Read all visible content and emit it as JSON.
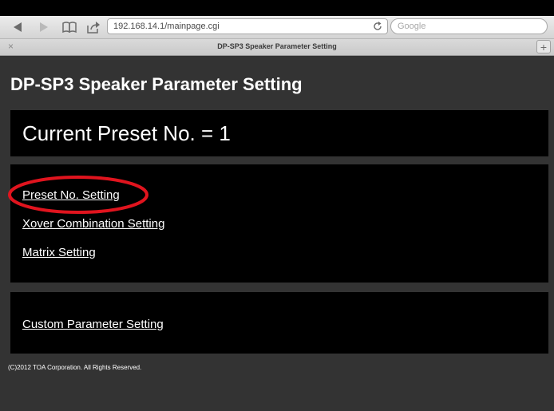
{
  "browser": {
    "url": "192.168.14.1/mainpage.cgi",
    "search_placeholder": "Google",
    "tab_title": "DP-SP3 Speaker Parameter Setting",
    "tab_close": "×",
    "tab_add": "+"
  },
  "page": {
    "heading": "DP-SP3 Speaker Parameter Setting",
    "current_preset": "Current Preset No. = 1",
    "links": [
      "Preset No. Setting",
      "Xover Combination Setting",
      "Matrix Setting"
    ],
    "custom_link": "Custom Parameter Setting",
    "footer": "(C)2012 TOA Corporation. All Rights Reserved."
  },
  "annotation": {
    "highlight_color": "#e0141e"
  },
  "colors": {
    "page_background": "#333333",
    "panel_background": "#000000",
    "text": "#ffffff"
  },
  "icons": [
    "back-icon",
    "forward-icon",
    "bookmarks-icon",
    "share-icon",
    "reload-icon"
  ]
}
